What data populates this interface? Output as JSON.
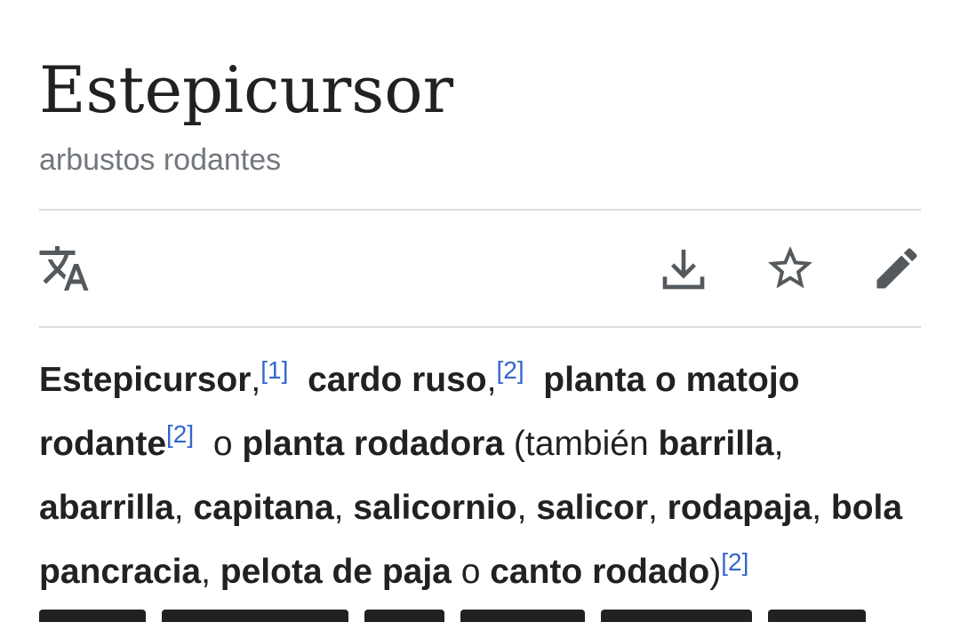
{
  "article": {
    "title": "Estepicursor",
    "subtitle": "arbustos rodantes"
  },
  "toolbar": {
    "language_icon": "translate-icon",
    "download_icon": "download-icon",
    "save_icon": "star-icon",
    "edit_icon": "pencil-icon"
  },
  "intro": {
    "t1": "Estepicursor",
    "t2": ",",
    "ref1": "[1]",
    "t3": "cardo ruso",
    "t4": ",",
    "ref2": "[2]",
    "t5": "planta o matojo rodante",
    "ref3": "[2]",
    "t6": " o ",
    "t7": "planta rodadora",
    "t8": " (también ",
    "t9": "barrilla",
    "t10": ", ",
    "t11": "abarrilla",
    "t12": ", ",
    "t13": "capitana",
    "t14": ", ",
    "t15": "salicornio",
    "t16": ", ",
    "t17": "salicor",
    "t18": ", ",
    "t19": "rodapaja",
    "t20": ", ",
    "t21": "bola pancracia",
    "t22": ", ",
    "t23": "pelota de paja",
    "t24": " o ",
    "t25": "canto rodado",
    "t26": ")",
    "ref4": "[2]"
  },
  "colors": {
    "text": "#202122",
    "subtle": "#72777d",
    "link": "#3366cc",
    "divider": "#dadce0",
    "icon": "#54595d"
  }
}
